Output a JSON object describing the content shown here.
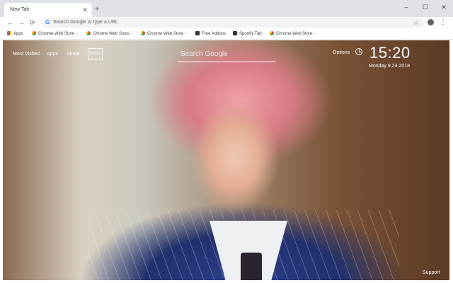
{
  "tab": {
    "title": "New Tab",
    "close": "✕"
  },
  "new_tab_button": "+",
  "window_controls": {
    "minimize": "–",
    "maximize": "☐",
    "close": "✕"
  },
  "nav": {
    "back": "←",
    "forward": "→",
    "reload": "⟳"
  },
  "omnibox": {
    "placeholder": "Search Google or type a URL",
    "google_glyph": "G"
  },
  "bookmarks": [
    {
      "label": "Apps",
      "icon": "apps-grid-icon"
    },
    {
      "label": "Chrome Web Store -",
      "icon": "chrome-web-store-icon"
    },
    {
      "label": "Chrome Web Store -",
      "icon": "chrome-web-store-icon"
    },
    {
      "label": "Chrome Web Store -",
      "icon": "chrome-web-store-icon"
    },
    {
      "label": "Free Addons",
      "icon": "free-addons-icon"
    },
    {
      "label": "Sportify Tab",
      "icon": "sportify-tab-icon"
    },
    {
      "label": "Chrome Web Store -",
      "icon": "chrome-web-store-icon"
    }
  ],
  "newtab": {
    "links": {
      "most_visited": "Most Visited",
      "apps": "Apps",
      "share": "Share",
      "radio": "Radio"
    },
    "search_placeholder": "Search Google",
    "options": "Options",
    "time": "15:20",
    "date": "Monday  9.24.2018",
    "support": "Support"
  },
  "colors": {
    "tabstrip": "#dee1e6",
    "toolbar": "#ffffff",
    "omnibox": "#f1f3f4",
    "overlay_text": "#ffffff"
  }
}
